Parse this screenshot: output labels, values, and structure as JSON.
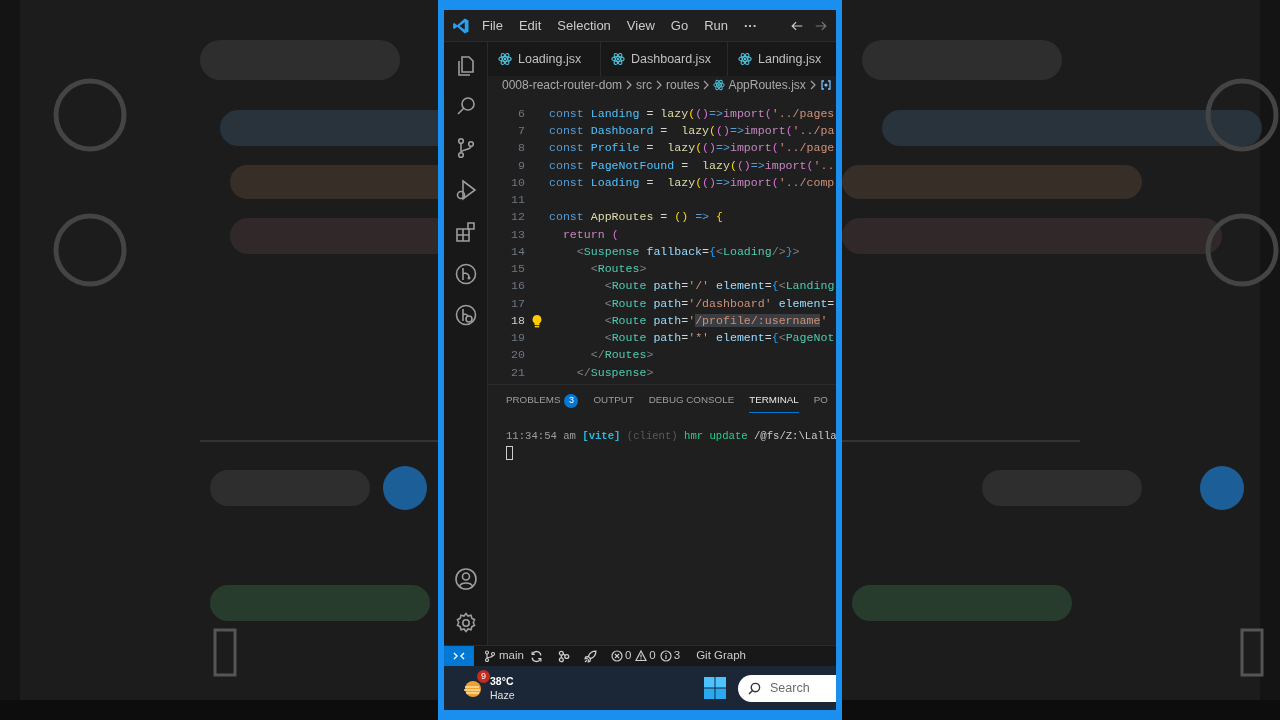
{
  "title_bar": {
    "menu": [
      "File",
      "Edit",
      "Selection",
      "View",
      "Go",
      "Run"
    ],
    "more": "···"
  },
  "tabs": [
    {
      "label": "Loading.jsx",
      "selected": false
    },
    {
      "label": "Dashboard.jsx",
      "selected": false
    },
    {
      "label": "Landing.jsx",
      "selected": false
    }
  ],
  "breadcrumb": [
    "0008-react-router-dom",
    "src",
    "routes",
    "AppRoutes.jsx"
  ],
  "editor": {
    "lines": [
      {
        "number": "6",
        "current": false,
        "lightbulb": false,
        "tokens": [
          {
            "kind": "kw",
            "text": "const "
          },
          {
            "kind": "var",
            "text": "Landing"
          },
          {
            "kind": "op",
            "text": " = "
          },
          {
            "kind": "fn",
            "text": "lazy"
          },
          {
            "kind": "p1",
            "text": "("
          },
          {
            "kind": "p2",
            "text": "()"
          },
          {
            "kind": "kw",
            "text": "=>"
          },
          {
            "kind": "ctrl",
            "text": "import"
          },
          {
            "kind": "p2",
            "text": "("
          },
          {
            "kind": "str",
            "text": "'../pages"
          }
        ]
      },
      {
        "number": "7",
        "current": false,
        "lightbulb": false,
        "tokens": [
          {
            "kind": "kw",
            "text": "const "
          },
          {
            "kind": "var",
            "text": "Dashboard"
          },
          {
            "kind": "op",
            "text": " =  "
          },
          {
            "kind": "fn",
            "text": "lazy"
          },
          {
            "kind": "p1",
            "text": "("
          },
          {
            "kind": "p2",
            "text": "()"
          },
          {
            "kind": "kw",
            "text": "=>"
          },
          {
            "kind": "ctrl",
            "text": "import"
          },
          {
            "kind": "p2",
            "text": "("
          },
          {
            "kind": "str",
            "text": "'../pa"
          }
        ]
      },
      {
        "number": "8",
        "current": false,
        "lightbulb": false,
        "tokens": [
          {
            "kind": "kw",
            "text": "const "
          },
          {
            "kind": "var",
            "text": "Profile"
          },
          {
            "kind": "op",
            "text": " =  "
          },
          {
            "kind": "fn",
            "text": "lazy"
          },
          {
            "kind": "p1",
            "text": "("
          },
          {
            "kind": "p2",
            "text": "()"
          },
          {
            "kind": "kw",
            "text": "=>"
          },
          {
            "kind": "ctrl",
            "text": "import"
          },
          {
            "kind": "p2",
            "text": "("
          },
          {
            "kind": "str",
            "text": "'../page"
          }
        ]
      },
      {
        "number": "9",
        "current": false,
        "lightbulb": false,
        "tokens": [
          {
            "kind": "kw",
            "text": "const "
          },
          {
            "kind": "var",
            "text": "PageNotFound"
          },
          {
            "kind": "op",
            "text": " =  "
          },
          {
            "kind": "fn",
            "text": "lazy"
          },
          {
            "kind": "p1",
            "text": "("
          },
          {
            "kind": "p2",
            "text": "()"
          },
          {
            "kind": "kw",
            "text": "=>"
          },
          {
            "kind": "ctrl",
            "text": "import"
          },
          {
            "kind": "p2",
            "text": "("
          },
          {
            "kind": "str",
            "text": "'.."
          }
        ]
      },
      {
        "number": "10",
        "current": false,
        "lightbulb": false,
        "tokens": [
          {
            "kind": "kw",
            "text": "const "
          },
          {
            "kind": "var",
            "text": "Loading"
          },
          {
            "kind": "op",
            "text": " =  "
          },
          {
            "kind": "fn",
            "text": "lazy"
          },
          {
            "kind": "p1",
            "text": "("
          },
          {
            "kind": "p2",
            "text": "()"
          },
          {
            "kind": "kw",
            "text": "=>"
          },
          {
            "kind": "ctrl",
            "text": "import"
          },
          {
            "kind": "p2",
            "text": "("
          },
          {
            "kind": "str",
            "text": "'../comp"
          }
        ]
      },
      {
        "number": "11",
        "current": false,
        "lightbulb": false
      },
      {
        "number": "12",
        "current": false,
        "lightbulb": false,
        "tokens": [
          {
            "kind": "kw",
            "text": "const "
          },
          {
            "kind": "fn",
            "text": "AppRoutes"
          },
          {
            "kind": "op",
            "text": " = "
          },
          {
            "kind": "p1",
            "text": "()"
          },
          {
            "kind": "kw",
            "text": " => "
          },
          {
            "kind": "p1",
            "text": "{"
          }
        ]
      },
      {
        "number": "13",
        "current": false,
        "lightbulb": false,
        "tokens": [
          {
            "kind": "ctrl",
            "text": "  return "
          },
          {
            "kind": "p2",
            "text": "("
          }
        ]
      },
      {
        "number": "14",
        "current": false,
        "lightbulb": false,
        "tokens": [
          {
            "kind": "tagb",
            "text": "    <"
          },
          {
            "kind": "tag",
            "text": "Suspense "
          },
          {
            "kind": "attr",
            "text": "fallback"
          },
          {
            "kind": "op",
            "text": "="
          },
          {
            "kind": "p3",
            "text": "{"
          },
          {
            "kind": "tagb",
            "text": "<"
          },
          {
            "kind": "tag",
            "text": "Loading"
          },
          {
            "kind": "tagb",
            "text": "/>"
          },
          {
            "kind": "p3",
            "text": "}"
          },
          {
            "kind": "tagb",
            "text": ">"
          }
        ]
      },
      {
        "number": "15",
        "current": false,
        "lightbulb": false,
        "tokens": [
          {
            "kind": "tagb",
            "text": "      <"
          },
          {
            "kind": "tag",
            "text": "Routes"
          },
          {
            "kind": "tagb",
            "text": ">"
          }
        ]
      },
      {
        "number": "16",
        "current": false,
        "lightbulb": false,
        "tokens": [
          {
            "kind": "tagb",
            "text": "        <"
          },
          {
            "kind": "tag",
            "text": "Route "
          },
          {
            "kind": "attr",
            "text": "path"
          },
          {
            "kind": "op",
            "text": "="
          },
          {
            "kind": "str",
            "text": "'/' "
          },
          {
            "kind": "attr",
            "text": "element"
          },
          {
            "kind": "op",
            "text": "="
          },
          {
            "kind": "p3",
            "text": "{"
          },
          {
            "kind": "tagb",
            "text": "<"
          },
          {
            "kind": "tag",
            "text": "Landing"
          }
        ]
      },
      {
        "number": "17",
        "current": false,
        "lightbulb": false,
        "tokens": [
          {
            "kind": "tagb",
            "text": "        <"
          },
          {
            "kind": "tag",
            "text": "Route "
          },
          {
            "kind": "attr",
            "text": "path"
          },
          {
            "kind": "op",
            "text": "="
          },
          {
            "kind": "str",
            "text": "'/dashboard' "
          },
          {
            "kind": "attr",
            "text": "element"
          },
          {
            "kind": "op",
            "text": "="
          }
        ]
      },
      {
        "number": "18",
        "current": true,
        "lightbulb": true,
        "tokens": [
          {
            "kind": "tagb",
            "text": "        <"
          },
          {
            "kind": "tag",
            "text": "Route "
          },
          {
            "kind": "attr",
            "text": "path"
          },
          {
            "kind": "op",
            "text": "="
          },
          {
            "kind": "str",
            "text": "'"
          },
          {
            "kind": "strsel",
            "text": "/profile/:username"
          },
          {
            "kind": "str",
            "text": "'"
          }
        ]
      },
      {
        "number": "19",
        "current": false,
        "lightbulb": false,
        "tokens": [
          {
            "kind": "tagb",
            "text": "        <"
          },
          {
            "kind": "tag",
            "text": "Route "
          },
          {
            "kind": "attr",
            "text": "path"
          },
          {
            "kind": "op",
            "text": "="
          },
          {
            "kind": "str",
            "text": "'*' "
          },
          {
            "kind": "attr",
            "text": "element"
          },
          {
            "kind": "op",
            "text": "="
          },
          {
            "kind": "p3",
            "text": "{"
          },
          {
            "kind": "tagb",
            "text": "<"
          },
          {
            "kind": "tag",
            "text": "PageNot"
          }
        ]
      },
      {
        "number": "20",
        "current": false,
        "lightbulb": false,
        "tokens": [
          {
            "kind": "tagb",
            "text": "      </"
          },
          {
            "kind": "tag",
            "text": "Routes"
          },
          {
            "kind": "tagb",
            "text": ">"
          }
        ]
      },
      {
        "number": "21",
        "current": false,
        "lightbulb": false,
        "tokens": [
          {
            "kind": "tagb",
            "text": "    </"
          },
          {
            "kind": "tag",
            "text": "Suspense"
          },
          {
            "kind": "tagb",
            "text": ">"
          }
        ]
      }
    ]
  },
  "panel": {
    "tabs": [
      {
        "label": "PROBLEMS",
        "badge": "3",
        "selected": false
      },
      {
        "label": "OUTPUT",
        "selected": false
      },
      {
        "label": "DEBUG CONSOLE",
        "selected": false
      },
      {
        "label": "TERMINAL",
        "selected": true
      },
      {
        "label": "PO",
        "selected": false
      }
    ],
    "terminal": {
      "tokens": [
        {
          "kind": "time",
          "text": "11:34:54 am "
        },
        {
          "kind": "vite",
          "text": "[vite]"
        },
        {
          "kind": "dim",
          "text": " (client) "
        },
        {
          "kind": "green",
          "text": "hmr update"
        },
        {
          "kind": "plain",
          "text": " /@fs/Z:\\Lalla"
        }
      ]
    }
  },
  "status_bar": {
    "branch": "main",
    "errors": "0",
    "warnings": "0",
    "infos": "3",
    "git_graph": "Git Graph"
  },
  "taskbar": {
    "weather": {
      "badge": "9",
      "temperature": "38°C",
      "condition": "Haze"
    },
    "search": {
      "placeholder": "Search"
    }
  }
}
